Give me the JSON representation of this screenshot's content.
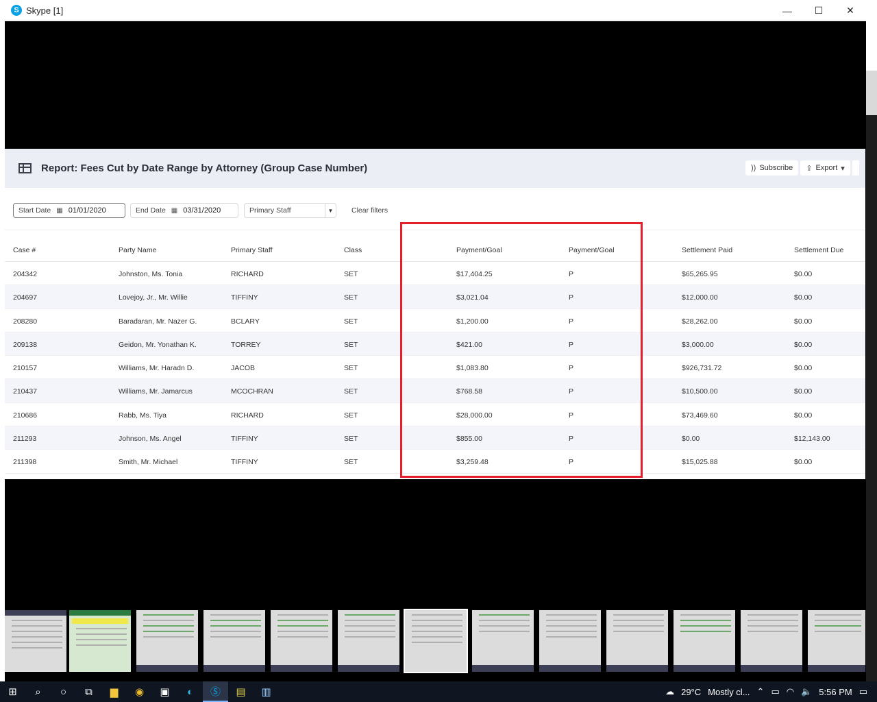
{
  "window": {
    "title": "Skype [1]",
    "controls": {
      "minimize": "—",
      "maximize": "☐",
      "close": "✕"
    }
  },
  "report": {
    "title": "Report: Fees Cut by Date Range by Attorney (Group Case Number)",
    "subscribe_label": "Subscribe",
    "export_label": "Export"
  },
  "filters": {
    "start_label": "Start Date",
    "start_value": "01/01/2020",
    "end_label": "End Date",
    "end_value": "03/31/2020",
    "staff_placeholder": "Primary Staff",
    "clear_label": "Clear filters"
  },
  "table": {
    "columns": [
      "Case #",
      "Party Name",
      "Primary Staff",
      "Class",
      "Payment/Goal",
      "Payment/Goal",
      "Settlement Paid",
      "Settlement Due"
    ],
    "rows": [
      [
        "204342",
        "Johnston, Ms. Tonia",
        "RICHARD",
        "SET",
        "$17,404.25",
        "P",
        "$65,265.95",
        "$0.00"
      ],
      [
        "204697",
        "Lovejoy, Jr., Mr. Willie",
        "TIFFINY",
        "SET",
        "$3,021.04",
        "P",
        "$12,000.00",
        "$0.00"
      ],
      [
        "208280",
        "Baradaran, Mr. Nazer G.",
        "BCLARY",
        "SET",
        "$1,200.00",
        "P",
        "$28,262.00",
        "$0.00"
      ],
      [
        "209138",
        "Geidon, Mr. Yonathan K.",
        "TORREY",
        "SET",
        "$421.00",
        "P",
        "$3,000.00",
        "$0.00"
      ],
      [
        "210157",
        "Williams, Mr. Haradn D.",
        "JACOB",
        "SET",
        "$1,083.80",
        "P",
        "$926,731.72",
        "$0.00"
      ],
      [
        "210437",
        "Williams, Mr. Jamarcus",
        "MCOCHRAN",
        "SET",
        "$768.58",
        "P",
        "$10,500.00",
        "$0.00"
      ],
      [
        "210686",
        "Rabb, Ms. Tiya",
        "RICHARD",
        "SET",
        "$28,000.00",
        "P",
        "$73,469.60",
        "$0.00"
      ],
      [
        "211293",
        "Johnson, Ms. Angel",
        "TIFFINY",
        "SET",
        "$855.00",
        "P",
        "$0.00",
        "$12,143.00"
      ],
      [
        "211398",
        "Smith, Mr. Michael",
        "TIFFINY",
        "SET",
        "$3,259.48",
        "P",
        "$15,025.88",
        "$0.00"
      ]
    ]
  },
  "taskbar": {
    "weather_temp": "29°C",
    "weather_text": "Mostly cl...",
    "time": "5:56 PM"
  },
  "colors": {
    "highlight": "#e3202b",
    "skype_blue": "#0aa1e4",
    "header_bg": "#eceef6"
  }
}
